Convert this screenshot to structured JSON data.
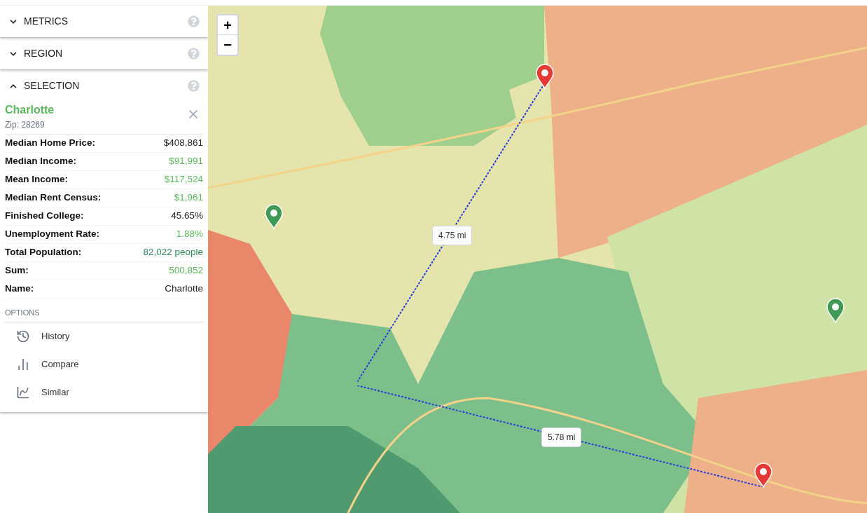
{
  "sections": [
    {
      "title": "METRICS",
      "expanded": false
    },
    {
      "title": "REGION",
      "expanded": false
    },
    {
      "title": "SELECTION",
      "expanded": true
    }
  ],
  "selection": {
    "name": "Charlotte",
    "zip": "Zip: 28269",
    "stats": [
      {
        "label": "Median Home Price:",
        "value": "$408,861",
        "color": "#222222"
      },
      {
        "label": "Median Income:",
        "value": "$91,991",
        "color": "#5cb85c"
      },
      {
        "label": "Mean Income:",
        "value": "$117,524",
        "color": "#5cb85c"
      },
      {
        "label": "Median Rent Census:",
        "value": "$1,961",
        "color": "#5cb85c"
      },
      {
        "label": "Finished College:",
        "value": "45.65%",
        "color": "#222222"
      },
      {
        "label": "Unemployment Rate:",
        "value": "1.88%",
        "color": "#5cb85c"
      },
      {
        "label": "Total Population:",
        "value": "82,022 people",
        "color": "#2e8b57"
      },
      {
        "label": "Sum:",
        "value": "500,852",
        "color": "#5cb85c"
      },
      {
        "label": "Name:",
        "value": "Charlotte",
        "color": "#222222"
      }
    ],
    "options_heading": "OPTIONS",
    "options": [
      {
        "kind": "history",
        "label": "History"
      },
      {
        "kind": "compare",
        "label": "Compare"
      },
      {
        "kind": "similar",
        "label": "Similar"
      }
    ]
  },
  "map": {
    "zoom_in": "+",
    "zoom_out": "−",
    "distances": [
      "4.75 mi",
      "5.78 mi"
    ]
  }
}
